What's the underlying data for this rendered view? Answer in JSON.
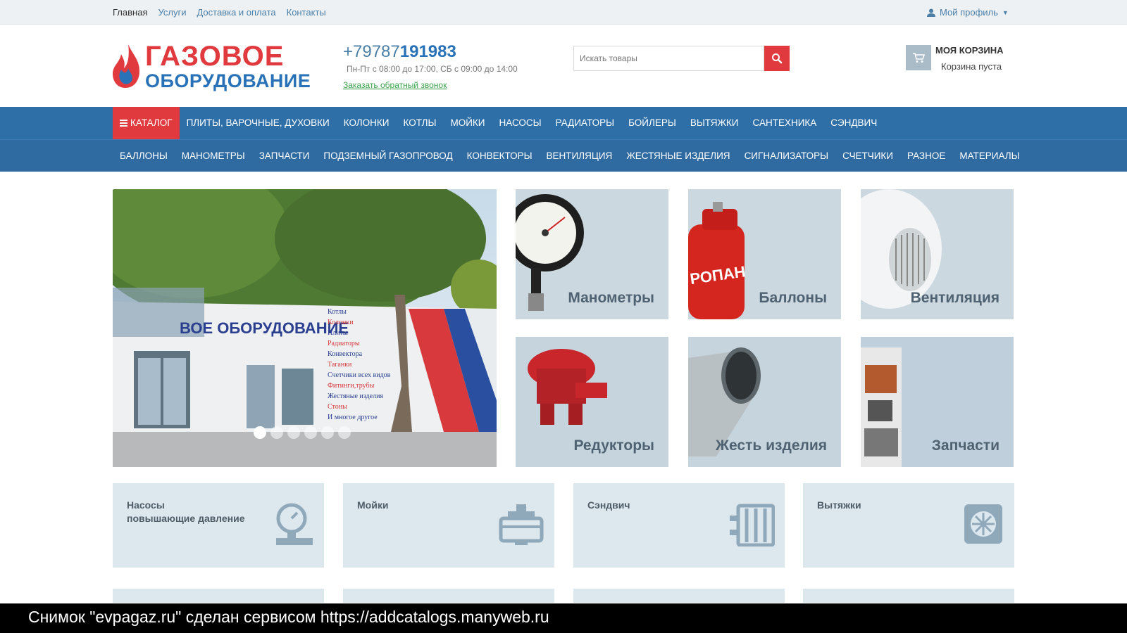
{
  "topbar": {
    "links": [
      "Главная",
      "Услуги",
      "Доставка и оплата",
      "Контакты"
    ],
    "profile": "Мой профиль"
  },
  "header": {
    "logo_line1": "ГАЗОВОЕ",
    "logo_line2": "ОБОРУДОВАНИЕ",
    "phone_prefix": "+79787",
    "phone_main": "191983",
    "hours": "Пн-Пт с 08:00 до 17:00, СБ с 09:00 до 14:00",
    "callback": "Заказать обратный звонок",
    "search_placeholder": "Искать товары",
    "cart_title": "МОЯ КОРЗИНА",
    "cart_status": "Корзина пуста"
  },
  "nav": {
    "catalog": "КАТАЛОГ",
    "row1": [
      "ПЛИТЫ, ВАРОЧНЫЕ, ДУХОВКИ",
      "КОЛОНКИ",
      "КОТЛЫ",
      "МОЙКИ",
      "НАСОСЫ",
      "РАДИАТОРЫ",
      "БОЙЛЕРЫ",
      "ВЫТЯЖКИ",
      "САНТЕХНИКА",
      "СЭНДВИЧ"
    ],
    "row2": [
      "БАЛЛОНЫ",
      "МАНОМЕТРЫ",
      "ЗАПЧАСТИ",
      "ПОДЗЕМНЫЙ ГАЗОПРОВОД",
      "КОНВЕКТОРЫ",
      "ВЕНТИЛЯЦИЯ",
      "ЖЕСТЯНЫЕ ИЗДЕЛИЯ",
      "СИГНАЛИЗАТОРЫ",
      "СЧЕТЧИКИ",
      "РАЗНОЕ",
      "МАТЕРИАЛЫ"
    ]
  },
  "hero": {
    "sign_text": "ВОЕ ОБОРУДОВАНИЕ",
    "list": [
      "Котлы",
      "Колонки",
      "Плиты",
      "Радиаторы",
      "Конвектора",
      "Таганки",
      "Счетчики всех видов",
      "Фитинги,трубы",
      "Жестяные изделия",
      "Стоны",
      "И многое другое"
    ],
    "slides_count": 6,
    "active_slide": 1
  },
  "tiles": [
    {
      "label": "Манометры",
      "icon": "pressure-gauge-icon"
    },
    {
      "label": "Баллоны",
      "icon": "gas-cylinder-icon"
    },
    {
      "label": "Вентиляция",
      "icon": "fan-duct-icon"
    },
    {
      "label": "Редукторы",
      "icon": "regulator-icon"
    },
    {
      "label": "Жесть изделия",
      "icon": "metal-pipe-icon"
    },
    {
      "label": "Запчасти",
      "icon": "boiler-parts-icon"
    }
  ],
  "cards": [
    {
      "title_line1": "Насосы",
      "title_line2": "повышающие давление",
      "icon": "pressure-pump-icon"
    },
    {
      "title_line1": "Мойки",
      "title_line2": "",
      "icon": "toolbox-icon"
    },
    {
      "title_line1": "Сэндвич",
      "title_line2": "",
      "icon": "radiator-icon"
    },
    {
      "title_line1": "Вытяжки",
      "title_line2": "",
      "icon": "hood-fan-icon"
    }
  ],
  "footer": {
    "text": "Снимок \"evpagaz.ru\" сделан сервисом https://addcatalogs.manyweb.ru"
  },
  "colors": {
    "accent_red": "#e03a3e",
    "brand_blue": "#2a72b8",
    "nav_blue": "#2e6fa8",
    "tile_bg": "#ccd8e0",
    "card_bg": "#dde7ee"
  }
}
